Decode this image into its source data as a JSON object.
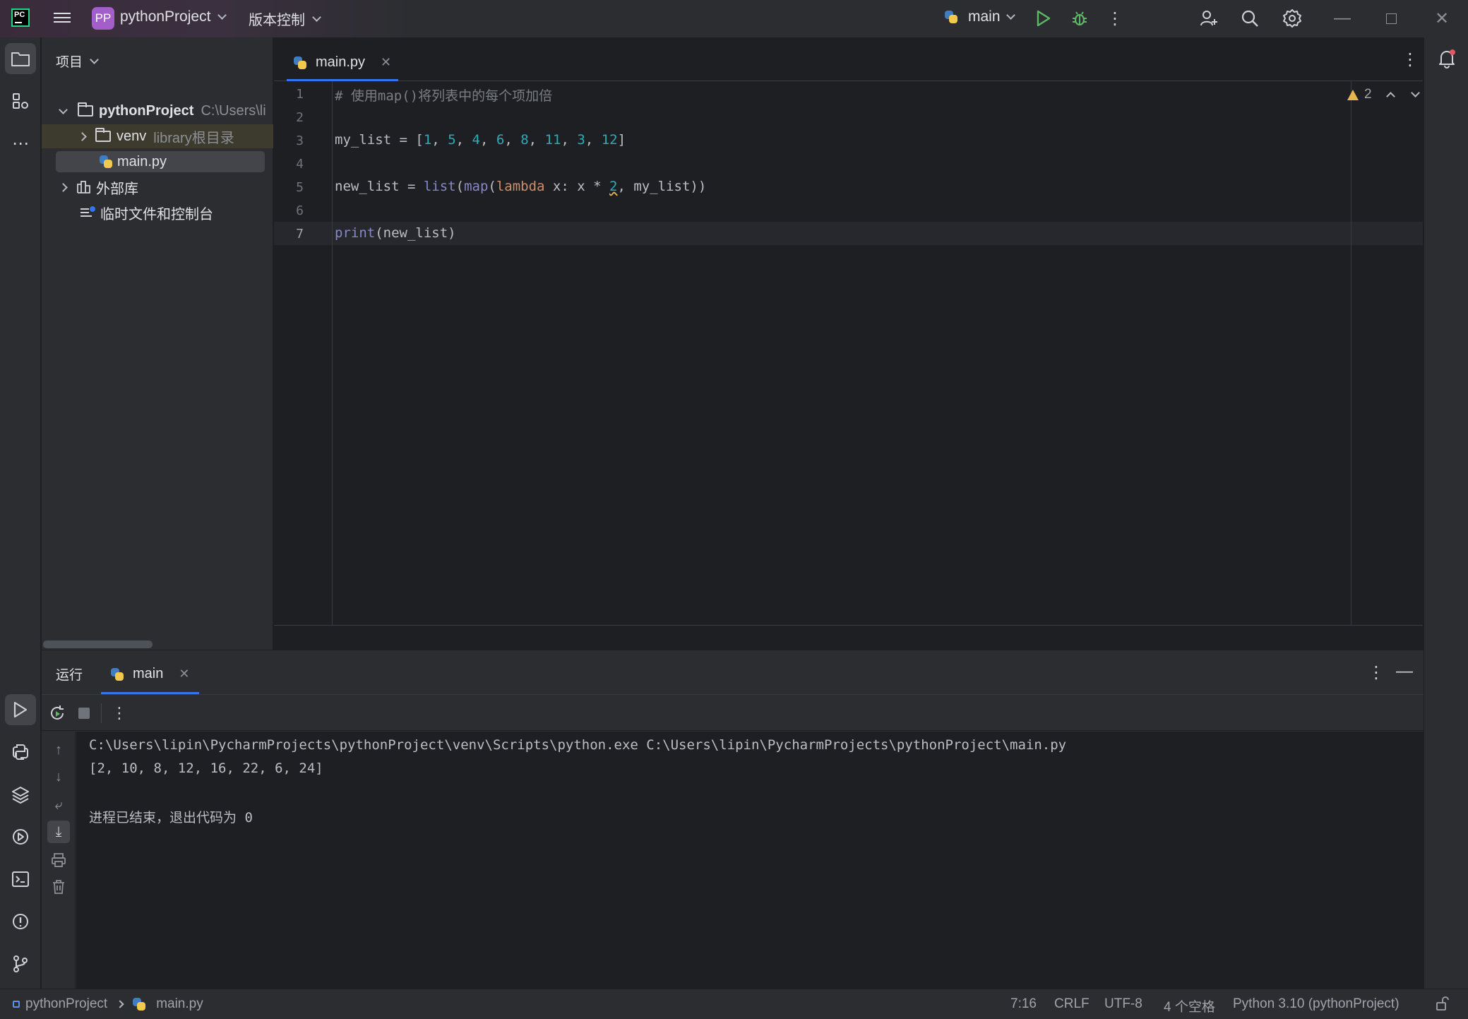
{
  "titlebar": {
    "project_badge": "PP",
    "project_name": "pythonProject",
    "vcs_label": "版本控制",
    "run_config": "main"
  },
  "project_panel": {
    "title": "项目",
    "tree": {
      "root_name": "pythonProject",
      "root_path": "C:\\Users\\li",
      "venv_name": "venv",
      "venv_note": "library根目录",
      "file_name": "main.py",
      "external_libs": "外部库",
      "scratches": "临时文件和控制台"
    }
  },
  "editor": {
    "tab_label": "main.py",
    "warnings_count": "2",
    "line_numbers": [
      "1",
      "2",
      "3",
      "4",
      "5",
      "6",
      "7"
    ],
    "code": {
      "line1_comment": "# 使用map()将列表中的每个项加倍",
      "line3_var": "my_list = [",
      "line3_nums": [
        "1",
        "5",
        "4",
        "6",
        "8",
        "11",
        "3",
        "12"
      ],
      "line5_var": "new_list = ",
      "line5_list": "list",
      "line5_map": "map",
      "line5_lambda": "lambda",
      "line5_rest1": " x: x * ",
      "line5_two": "2",
      "line5_rest2": ", my_list))",
      "line7_print": "print",
      "line7_arg": "(new_list)"
    }
  },
  "run_panel": {
    "label": "运行",
    "tab_label": "main",
    "output": {
      "command": "C:\\Users\\lipin\\PycharmProjects\\pythonProject\\venv\\Scripts\\python.exe C:\\Users\\lipin\\PycharmProjects\\pythonProject\\main.py",
      "result": "[2, 10, 8, 12, 16, 22, 6, 24]",
      "exit_message": "进程已结束，退出代码为 0"
    }
  },
  "statusbar": {
    "breadcrumb_project": "pythonProject",
    "breadcrumb_file": "main.py",
    "cursor_position": "7:16",
    "line_separator": "CRLF",
    "encoding": "UTF-8",
    "indent": "4 个空格",
    "interpreter": "Python 3.10 (pythonProject)"
  },
  "colors": {
    "accent": "#3574f0",
    "editor_bg": "#1e1f22",
    "panel_bg": "#2b2d30",
    "number": "#2aacb8",
    "keyword": "#cf8e6d",
    "builtin": "#8888c6",
    "comment": "#7a7e85",
    "warning": "#e5b54e"
  },
  "icons": [
    "pycharm-logo-icon",
    "hamburger-menu-icon",
    "python-icon",
    "run-icon",
    "debug-icon",
    "more-icon",
    "add-user-icon",
    "search-icon",
    "settings-gear-icon",
    "minimize-icon",
    "maximize-icon",
    "close-icon",
    "folder-icon",
    "structure-icon",
    "notifications-icon",
    "rerun-icon",
    "stop-icon",
    "terminal-icon",
    "problems-icon",
    "git-icon",
    "layers-icon",
    "services-icon",
    "print-icon",
    "trash-icon",
    "lock-icon"
  ]
}
